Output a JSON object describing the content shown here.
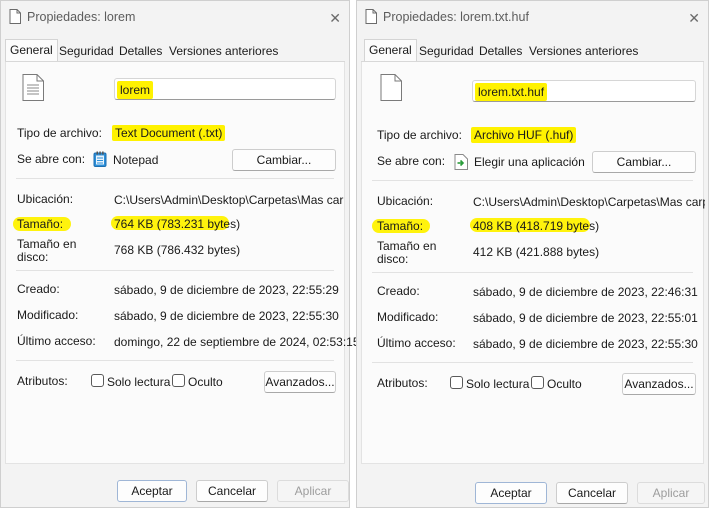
{
  "common": {
    "tabs": [
      "General",
      "Seguridad",
      "Detalles",
      "Versiones anteriores"
    ],
    "labels": {
      "tipo": "Tipo de archivo:",
      "abre": "Se abre con:",
      "ubicacion": "Ubicación:",
      "tamano": "Tamaño:",
      "tamano_disco_1": "Tamaño en",
      "tamano_disco_2": "disco:",
      "creado": "Creado:",
      "modificado": "Modificado:",
      "acceso": "Último acceso:",
      "atributos": "Atributos:"
    },
    "buttons": {
      "cambiar": "Cambiar...",
      "avanzados": "Avanzados...",
      "aceptar": "Aceptar",
      "cancelar": "Cancelar",
      "aplicar": "Aplicar"
    },
    "checkboxes": {
      "solo_lectura": "Solo lectura",
      "oculto": "Oculto"
    },
    "colors": {
      "highlight": "#fff200",
      "background": "#f3f3f3"
    }
  },
  "window1": {
    "title": "Propiedades: lorem",
    "name": "lorem",
    "tipo": "Text Document (.txt)",
    "abre": "Notepad",
    "abre_icon": "notepad-icon",
    "ubicacion": "C:\\Users\\Admin\\Desktop\\Carpetas\\Mas carpe",
    "tamano": "764 KB (783.231 bytes)",
    "tamano_disco": "768 KB (786.432 bytes)",
    "creado": "sábado, 9 de diciembre de 2023, 22:55:29",
    "modificado": "sábado, 9 de diciembre de 2023, 22:55:30",
    "acceso": "domingo, 22 de septiembre de 2024, 02:53:15"
  },
  "window2": {
    "title": "Propiedades: lorem.txt.huf",
    "name": "lorem.txt.huf",
    "tipo": "Archivo HUF (.huf)",
    "abre": "Elegir una aplicación",
    "abre_icon": "choose-app-icon",
    "ubicacion": "C:\\Users\\Admin\\Desktop\\Carpetas\\Mas carpe",
    "tamano": "408 KB (418.719 bytes)",
    "tamano_disco": "412 KB (421.888 bytes)",
    "creado": "sábado, 9 de diciembre de 2023, 22:46:31",
    "modificado": "sábado, 9 de diciembre de 2023, 22:55:01",
    "acceso": "sábado, 9 de diciembre de 2023, 22:55:30"
  }
}
